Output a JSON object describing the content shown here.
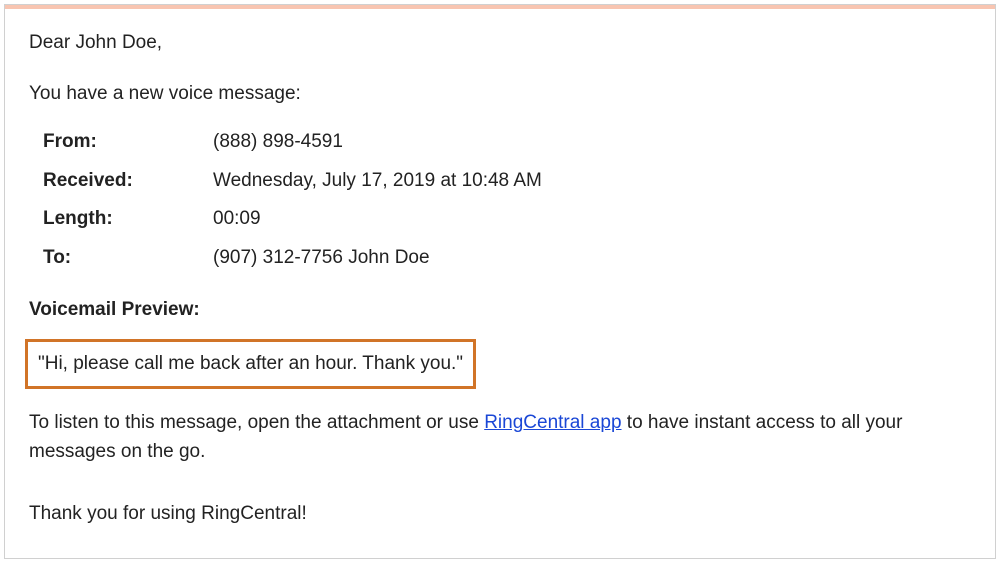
{
  "greeting": "Dear John Doe,",
  "intro": "You have a new voice message:",
  "details": {
    "from_label": "From:",
    "from_value": "(888) 898-4591",
    "received_label": "Received:",
    "received_value": "Wednesday, July 17, 2019 at 10:48 AM",
    "length_label": "Length:",
    "length_value": "00:09",
    "to_label": "To:",
    "to_value": "(907) 312-7756 John Doe"
  },
  "preview_heading": "Voicemail Preview:",
  "preview_text": "\"Hi, please call me back after an hour. Thank you.\"",
  "listen_prefix": "To listen to this message, open the attachment or use ",
  "listen_link": "RingCentral app",
  "listen_suffix": " to have instant access to all your messages on the go.",
  "thankyou": "Thank you for using RingCentral!"
}
